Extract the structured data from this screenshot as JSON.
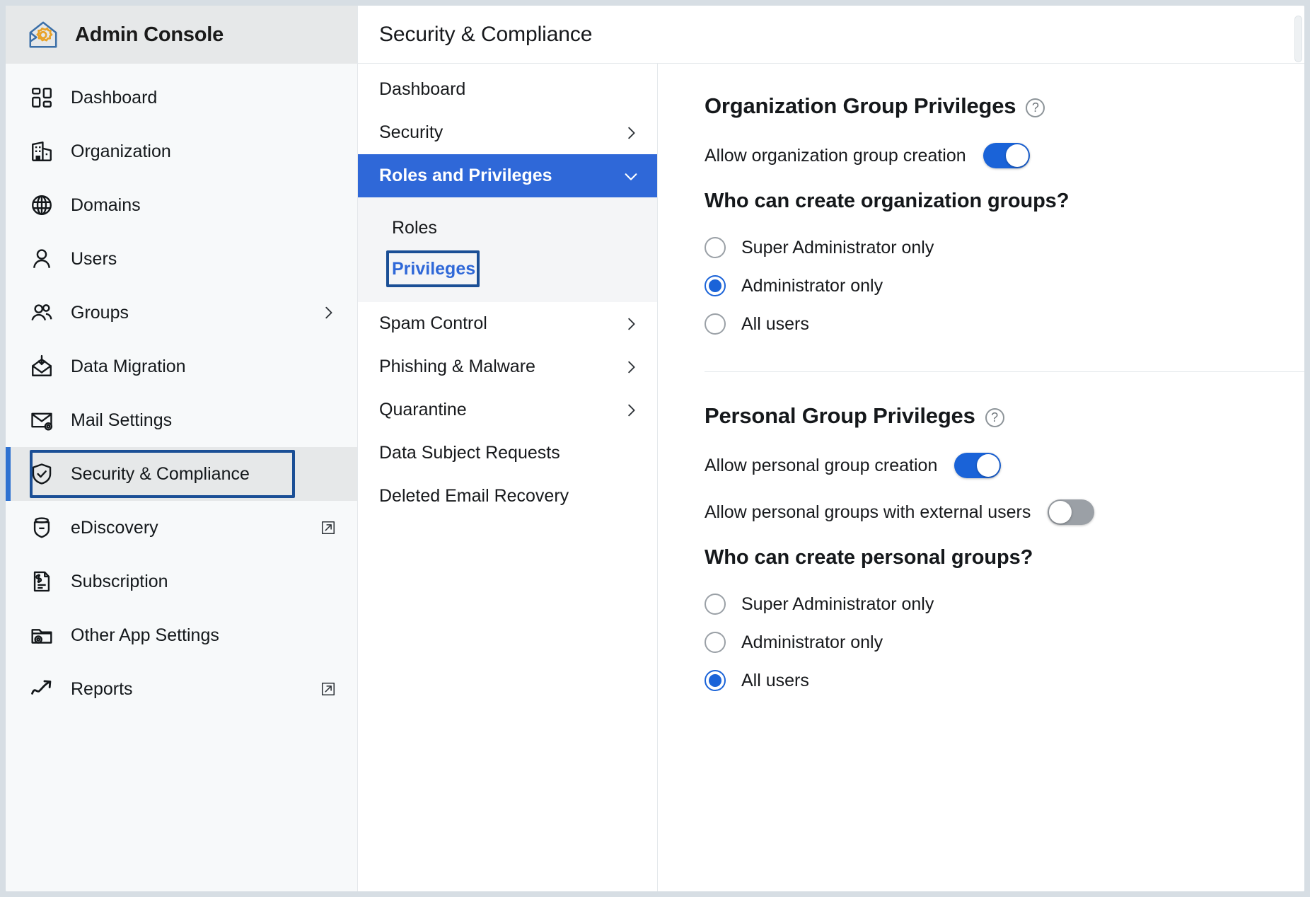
{
  "brand": {
    "title": "Admin Console",
    "logo_icon": "admin-console-logo-icon"
  },
  "sidebar": {
    "items": [
      {
        "label": "Dashboard",
        "icon": "dashboard-icon",
        "chevron": false,
        "external": false,
        "active": false
      },
      {
        "label": "Organization",
        "icon": "organization-icon",
        "chevron": false,
        "external": false,
        "active": false
      },
      {
        "label": "Domains",
        "icon": "globe-icon",
        "chevron": false,
        "external": false,
        "active": false
      },
      {
        "label": "Users",
        "icon": "user-icon",
        "chevron": false,
        "external": false,
        "active": false
      },
      {
        "label": "Groups",
        "icon": "groups-icon",
        "chevron": true,
        "external": false,
        "active": false
      },
      {
        "label": "Data Migration",
        "icon": "data-migration-icon",
        "chevron": false,
        "external": false,
        "active": false
      },
      {
        "label": "Mail Settings",
        "icon": "mail-settings-icon",
        "chevron": false,
        "external": false,
        "active": false
      },
      {
        "label": "Security & Compliance",
        "icon": "shield-check-icon",
        "chevron": false,
        "external": false,
        "active": true
      },
      {
        "label": "eDiscovery",
        "icon": "ediscovery-icon",
        "chevron": false,
        "external": true,
        "active": false
      },
      {
        "label": "Subscription",
        "icon": "subscription-icon",
        "chevron": false,
        "external": false,
        "active": false
      },
      {
        "label": "Other App Settings",
        "icon": "app-settings-icon",
        "chevron": false,
        "external": false,
        "active": false
      },
      {
        "label": "Reports",
        "icon": "reports-trend-icon",
        "chevron": false,
        "external": true,
        "active": false
      }
    ]
  },
  "header": {
    "title": "Security & Compliance"
  },
  "subnav": {
    "items": [
      {
        "label": "Dashboard",
        "chevron": "none",
        "state": "normal"
      },
      {
        "label": "Security",
        "chevron": "right",
        "state": "normal"
      },
      {
        "label": "Roles and Privileges",
        "chevron": "down",
        "state": "selected"
      },
      {
        "label": "Spam Control",
        "chevron": "right",
        "state": "normal"
      },
      {
        "label": "Phishing & Malware",
        "chevron": "right",
        "state": "normal"
      },
      {
        "label": "Quarantine",
        "chevron": "right",
        "state": "normal"
      },
      {
        "label": "Data Subject Requests",
        "chevron": "none",
        "state": "normal"
      },
      {
        "label": "Deleted Email Recovery",
        "chevron": "none",
        "state": "normal"
      }
    ],
    "subitems": [
      {
        "label": "Roles",
        "focused": false
      },
      {
        "label": "Privileges",
        "focused": true
      }
    ]
  },
  "content": {
    "org_section": {
      "title": "Organization Group Privileges",
      "help_icon": "question-mark-icon",
      "toggle": {
        "label": "Allow organization group creation",
        "on": true
      },
      "question": "Who can create organization groups?",
      "options": [
        {
          "label": "Super Administrator only",
          "selected": false
        },
        {
          "label": "Administrator only",
          "selected": true
        },
        {
          "label": "All users",
          "selected": false
        }
      ]
    },
    "personal_section": {
      "title": "Personal Group Privileges",
      "help_icon": "question-mark-icon",
      "toggles": [
        {
          "label": "Allow personal group creation",
          "on": true
        },
        {
          "label": "Allow personal groups with external users",
          "on": false
        }
      ],
      "question": "Who can create personal groups?",
      "options": [
        {
          "label": "Super Administrator only",
          "selected": false
        },
        {
          "label": "Administrator only",
          "selected": false
        },
        {
          "label": "All users",
          "selected": true
        }
      ]
    }
  },
  "colors": {
    "accent_blue": "#2f68d8",
    "toggle_on": "#1a63d8",
    "toggle_off": "#9ba0a6",
    "focus_outline": "#1b4f96",
    "sidebar_bg": "#f7f9fa"
  }
}
